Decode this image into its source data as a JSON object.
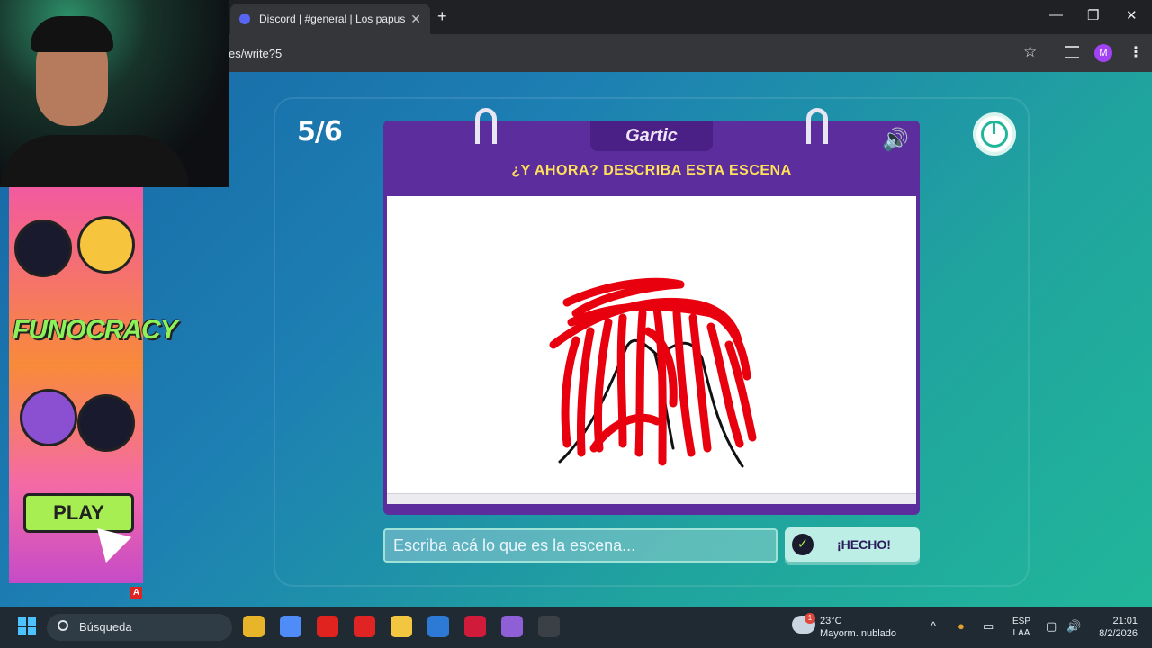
{
  "browser": {
    "tab_title": "Discord | #general | Los papus",
    "tab_close": "✕",
    "new_tab": "+",
    "url": "es/write?5",
    "profile_initial": "M",
    "window_controls": {
      "minimize": "—",
      "restore": "❐",
      "close": "✕"
    },
    "icons": [
      "discord-icon",
      "star-icon",
      "media-control-icon",
      "kebab-menu-icon"
    ]
  },
  "game": {
    "round_counter": "5/6",
    "logo_text": "Gartic",
    "prompt": "¿Y AHORA? DESCRIBA ESTA ESCENA",
    "guess_placeholder": "Escriba acá lo que es la escena...",
    "done_label": "¡HECHO!",
    "done_check": "✓",
    "speaker": "🔊",
    "colors": {
      "header": "#5c2d9c",
      "prompt": "#fee05a",
      "brush_red": "#e8000e",
      "brush_black": "#111111",
      "background_start": "#1767a5",
      "background_end": "#21b69a"
    }
  },
  "ad": {
    "logo_text": "FUNOCRACY",
    "play_label": "PLAY",
    "badge": "A"
  },
  "taskbar": {
    "search_label": "Búsqueda",
    "weather_badge": "1",
    "weather_temp": "23°C",
    "weather_desc": "Mayorm. nublado",
    "language_line1": "ESP",
    "language_line2": "LAA",
    "time": "21:01",
    "date": "8/2/2026",
    "tray_chevron": "^",
    "apps": [
      {
        "name": "chrome",
        "color": "#e8b52a"
      },
      {
        "name": "copilot",
        "color": "#4f8cf7"
      },
      {
        "name": "opera",
        "color": "#e0231f"
      },
      {
        "name": "youtube-music",
        "color": "#e02424"
      },
      {
        "name": "file-explorer",
        "color": "#f3c642"
      },
      {
        "name": "visual-studio",
        "color": "#2c7ad6"
      },
      {
        "name": "opera-gx",
        "color": "#d11b3a"
      },
      {
        "name": "chrome-profile",
        "color": "#8e5fd6"
      },
      {
        "name": "obs",
        "color": "#3b3f46"
      }
    ]
  }
}
